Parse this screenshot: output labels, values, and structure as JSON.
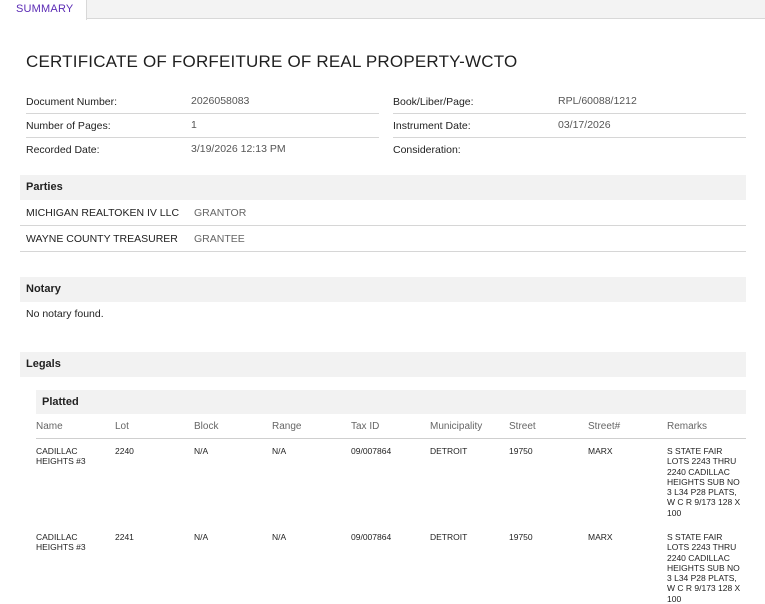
{
  "tabs": [
    {
      "label": "SUMMARY"
    }
  ],
  "document": {
    "title": "CERTIFICATE OF FORFEITURE OF REAL PROPERTY-WCTO",
    "fields_left": [
      {
        "label": "Document Number:",
        "value": "2026058083"
      },
      {
        "label": "Number of Pages:",
        "value": "1"
      },
      {
        "label": "Recorded Date:",
        "value": "3/19/2026 12:13 PM"
      }
    ],
    "fields_right": [
      {
        "label": "Book/Liber/Page:",
        "value": "RPL/60088/1212"
      },
      {
        "label": "Instrument Date:",
        "value": "03/17/2026"
      },
      {
        "label": "Consideration:",
        "value": ""
      }
    ]
  },
  "parties": {
    "heading": "Parties",
    "rows": [
      {
        "name": "MICHIGAN REALTOKEN IV LLC",
        "role": "GRANTOR"
      },
      {
        "name": "WAYNE COUNTY TREASURER",
        "role": "GRANTEE"
      }
    ]
  },
  "notary": {
    "heading": "Notary",
    "message": "No notary found."
  },
  "legals": {
    "heading": "Legals",
    "platted": {
      "heading": "Platted",
      "columns": [
        "Name",
        "Lot",
        "Block",
        "Range",
        "Tax ID",
        "Municipality",
        "Street",
        "Street#",
        "Remarks"
      ],
      "rows": [
        {
          "name": [
            "CADILLAC",
            "HEIGHTS #3"
          ],
          "lot": "2240",
          "block": "N/A",
          "range": "N/A",
          "tax_id": "09/007864",
          "municipality": "DETROIT",
          "street": "19750",
          "street_num": "MARX",
          "remarks": [
            "S STATE FAIR",
            "LOTS 2243 THRU",
            "2240 CADILLAC",
            "HEIGHTS SUB NO",
            "3 L34 P28 PLATS,",
            "W C R 9/173 128 X",
            "100"
          ]
        },
        {
          "name": [
            "CADILLAC",
            "HEIGHTS #3"
          ],
          "lot": "2241",
          "block": "N/A",
          "range": "N/A",
          "tax_id": "09/007864",
          "municipality": "DETROIT",
          "street": "19750",
          "street_num": "MARX",
          "remarks": [
            "S STATE FAIR",
            "LOTS 2243 THRU",
            "2240 CADILLAC",
            "HEIGHTS SUB NO",
            "3 L34 P28 PLATS,",
            "W C R 9/173 128 X",
            "100"
          ]
        }
      ]
    }
  }
}
